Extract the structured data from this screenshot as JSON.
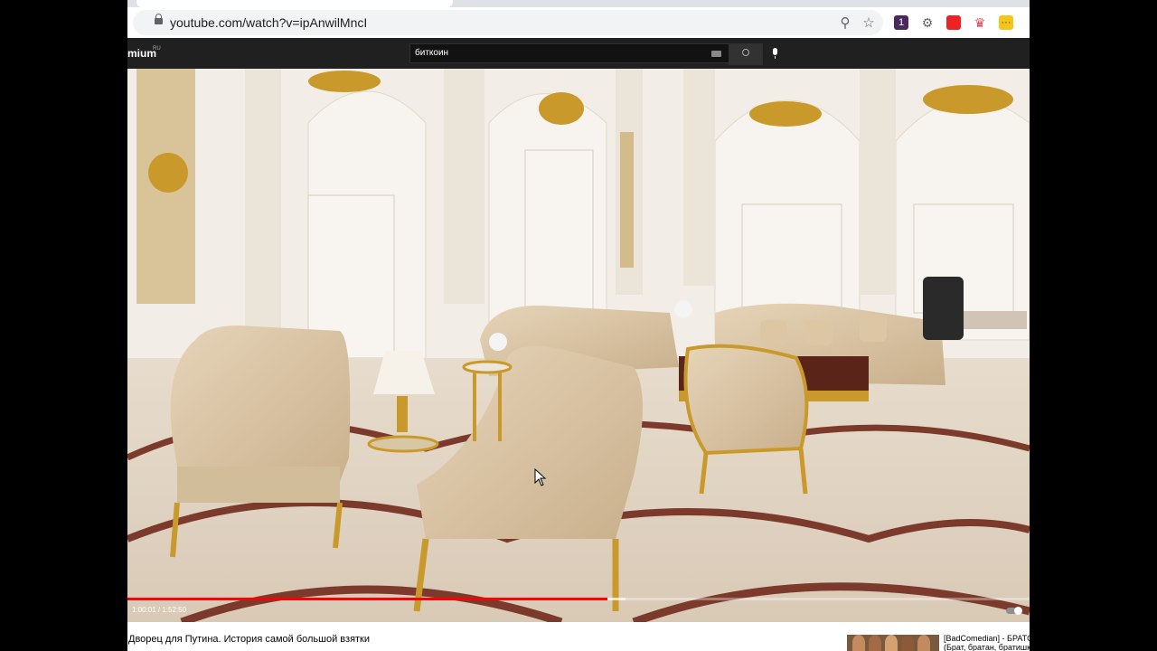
{
  "browser": {
    "url": "youtube.com/watch?v=ipAnwilMncI"
  },
  "masthead": {
    "logo_text": "mium",
    "logo_sup": "RU",
    "search_value": "биткоин"
  },
  "player": {
    "time_display": "1:00:01 / 1:52:50",
    "progress_fraction": 0.5319,
    "progress_color": "#ff0000"
  },
  "video": {
    "title": "Дворец для Путина. История самой большой взятки"
  },
  "recommendations": [
    {
      "title_line1": "[BadComedian] - БРАТСТВО",
      "title_line2": "(Брат, братан, братишка)"
    }
  ],
  "colors": {
    "masthead_bg": "#202020",
    "accent_red": "#ff0000"
  }
}
